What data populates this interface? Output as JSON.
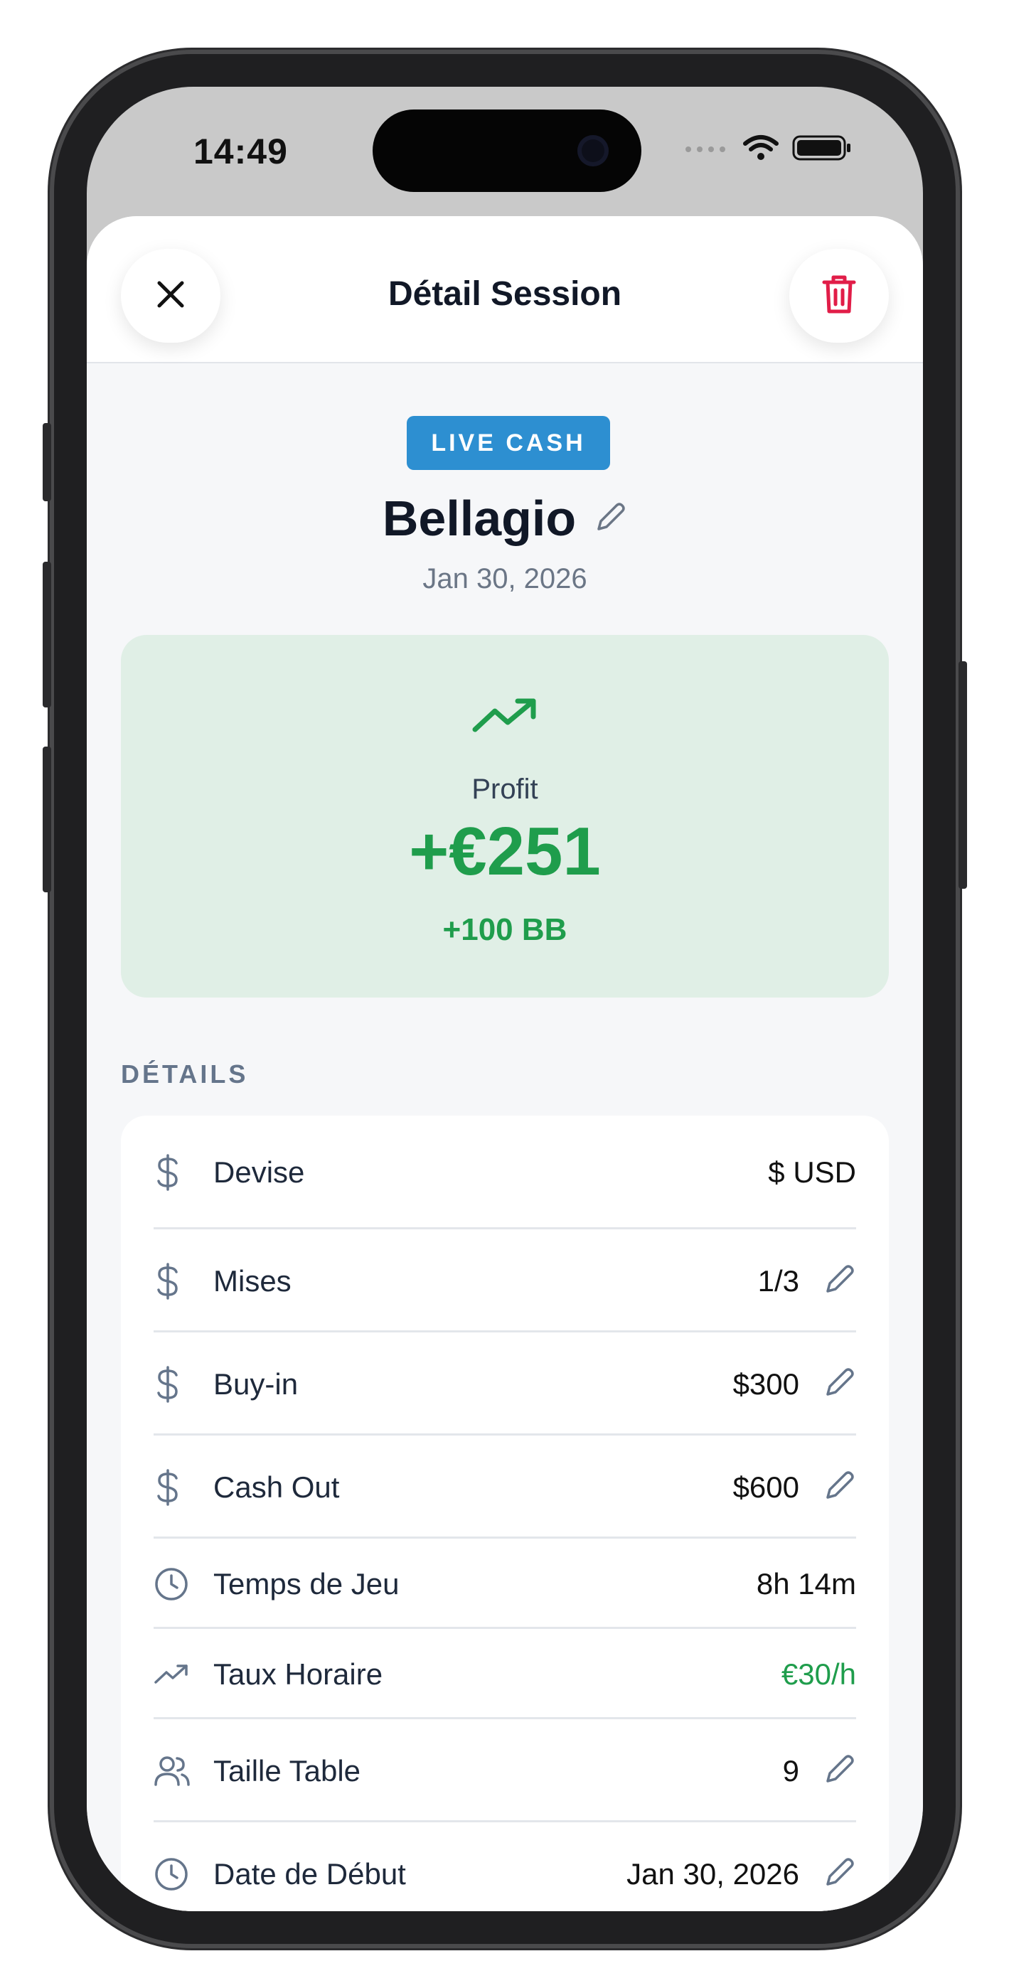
{
  "status_bar": {
    "time": "14:49"
  },
  "header": {
    "title": "Détail Session"
  },
  "session": {
    "type_badge": "LIVE CASH",
    "venue": "Bellagio",
    "date": "Jan 30, 2026"
  },
  "profit": {
    "label": "Profit",
    "value": "+€251",
    "bb": "+100 BB",
    "color": "#1f9d4c"
  },
  "details": {
    "section_title": "DÉTAILS",
    "rows": [
      {
        "icon": "dollar-icon",
        "label": "Devise",
        "value": "$ USD",
        "editable": false
      },
      {
        "icon": "dollar-icon",
        "label": "Mises",
        "value": "1/3",
        "editable": true
      },
      {
        "icon": "dollar-icon",
        "label": "Buy-in",
        "value": "$300",
        "editable": true
      },
      {
        "icon": "dollar-icon",
        "label": "Cash Out",
        "value": "$600",
        "editable": true
      },
      {
        "icon": "clock-icon",
        "label": "Temps de Jeu",
        "value": "8h 14m",
        "editable": false
      },
      {
        "icon": "trending-up-icon",
        "label": "Taux Horaire",
        "value": "€30/h",
        "editable": false,
        "highlight": true
      },
      {
        "icon": "users-icon",
        "label": "Taille Table",
        "value": "9",
        "editable": true
      },
      {
        "icon": "clock-icon",
        "label": "Date de Début",
        "value": "Jan 30, 2026",
        "editable": true
      }
    ]
  },
  "colors": {
    "accent_blue": "#2d8fd1",
    "profit_green": "#1f9d4c",
    "danger_red": "#e11d48"
  }
}
